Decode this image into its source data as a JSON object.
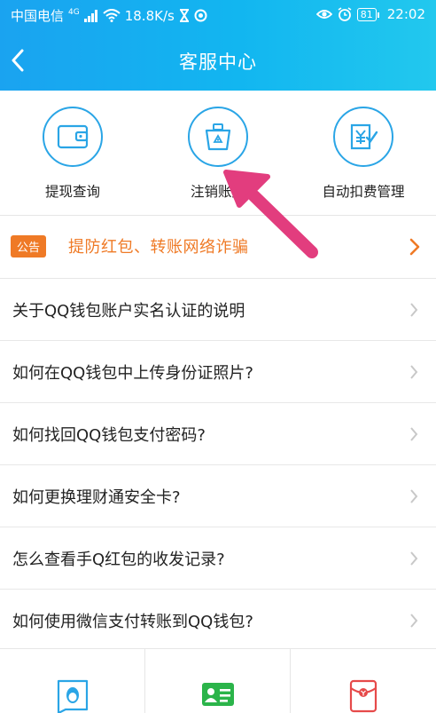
{
  "statusbar": {
    "carrier": "中国电信",
    "network_badge": "4G",
    "speed": "18.8K/s",
    "battery": "81",
    "time": "22:02"
  },
  "nav": {
    "title": "客服中心"
  },
  "quick_actions": [
    {
      "label": "提现查询",
      "icon": "wallet-icon"
    },
    {
      "label": "注销账户",
      "icon": "recycle-bin-icon"
    },
    {
      "label": "自动扣费管理",
      "icon": "yuan-document-icon"
    }
  ],
  "notice": {
    "badge": "公告",
    "text": "提防红包、转账网络诈骗"
  },
  "faq": [
    "关于QQ钱包账户实名认证的说明",
    "如何在QQ钱包中上传身份证照片?",
    "如何找回QQ钱包支付密码?",
    "如何更换理财通安全卡?",
    "怎么查看手Q红包的收发记录?",
    "如何使用微信支付转账到QQ钱包?"
  ],
  "bottom_bar": [
    {
      "icon": "qq-contact-icon"
    },
    {
      "icon": "id-card-icon"
    },
    {
      "icon": "red-envelope-icon"
    }
  ],
  "colors": {
    "accent": "#1aa3f0",
    "notice": "#ef7a26",
    "annotation_arrow": "#e23d7e"
  }
}
